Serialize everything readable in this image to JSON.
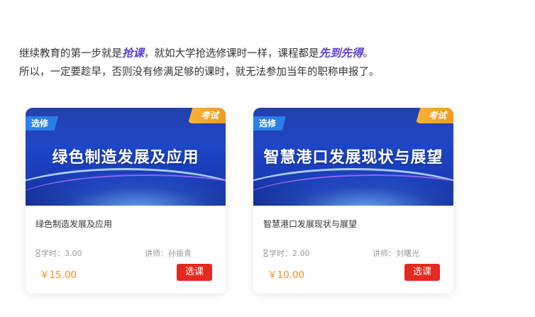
{
  "intro": {
    "line1_part1": "继续教育的第一步就是",
    "line1_hl1": "抢课",
    "line1_part2": "，就如大学抢选修课时一样，课程都是",
    "line1_hl2": "先到先得",
    "line1_part3": "。",
    "line2": "所以，一定要趁早，否则没有修满足够的课时，就无法参加当年的职称申报了。"
  },
  "colors": {
    "highlight": "#5b3fd6",
    "price": "#f5891d",
    "button": "#e5291f",
    "elective_tag": "#2b7fe8",
    "exam_tag": "#f39a1f"
  },
  "courses": [
    {
      "banner_title": "绿色制造发展及应用",
      "tag_elective": "选修",
      "tag_exam": "考试",
      "name": "绿色制造发展及应用",
      "hours": "学时：3.00",
      "teacher": "讲师：孙振青",
      "price": "￥15.00",
      "button": "选课",
      "hours_icon": "hourglass-icon"
    },
    {
      "banner_title": "智慧港口发展现状与展望",
      "tag_elective": "选修",
      "tag_exam": "考试",
      "name": "智慧港口发展现状与展望",
      "hours": "学时：2.00",
      "teacher": "讲师：刘曙光",
      "price": "￥10.00",
      "button": "选课",
      "hours_icon": "hourglass-icon"
    }
  ]
}
